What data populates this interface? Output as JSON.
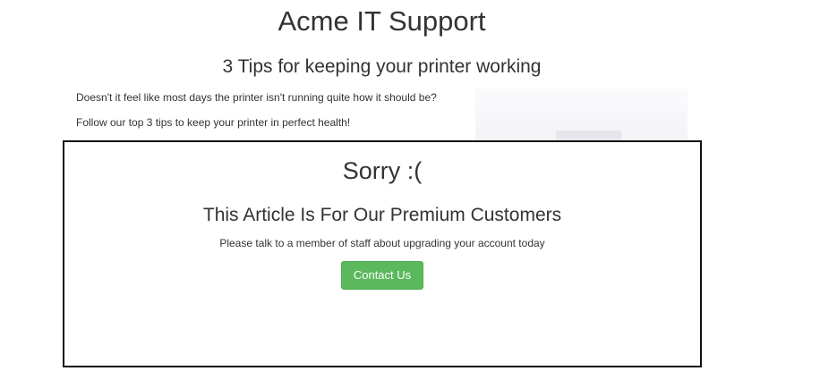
{
  "site": {
    "title": "Acme IT Support"
  },
  "article": {
    "title": "3 Tips for keeping your printer working",
    "intro": [
      "Doesn't it feel like most days the printer isn't running quite how it should be?",
      "Follow our top 3 tips to keep your printer in perfect health!"
    ]
  },
  "paywall": {
    "heading": "Sorry :(",
    "subheading": "This Article Is For Our Premium Customers",
    "message": "Please talk to a member of staff about upgrading your account today",
    "contact_label": "Contact Us"
  },
  "colors": {
    "button_bg": "#5cb85c",
    "button_text": "#ffffff",
    "modal_border": "#111111"
  }
}
